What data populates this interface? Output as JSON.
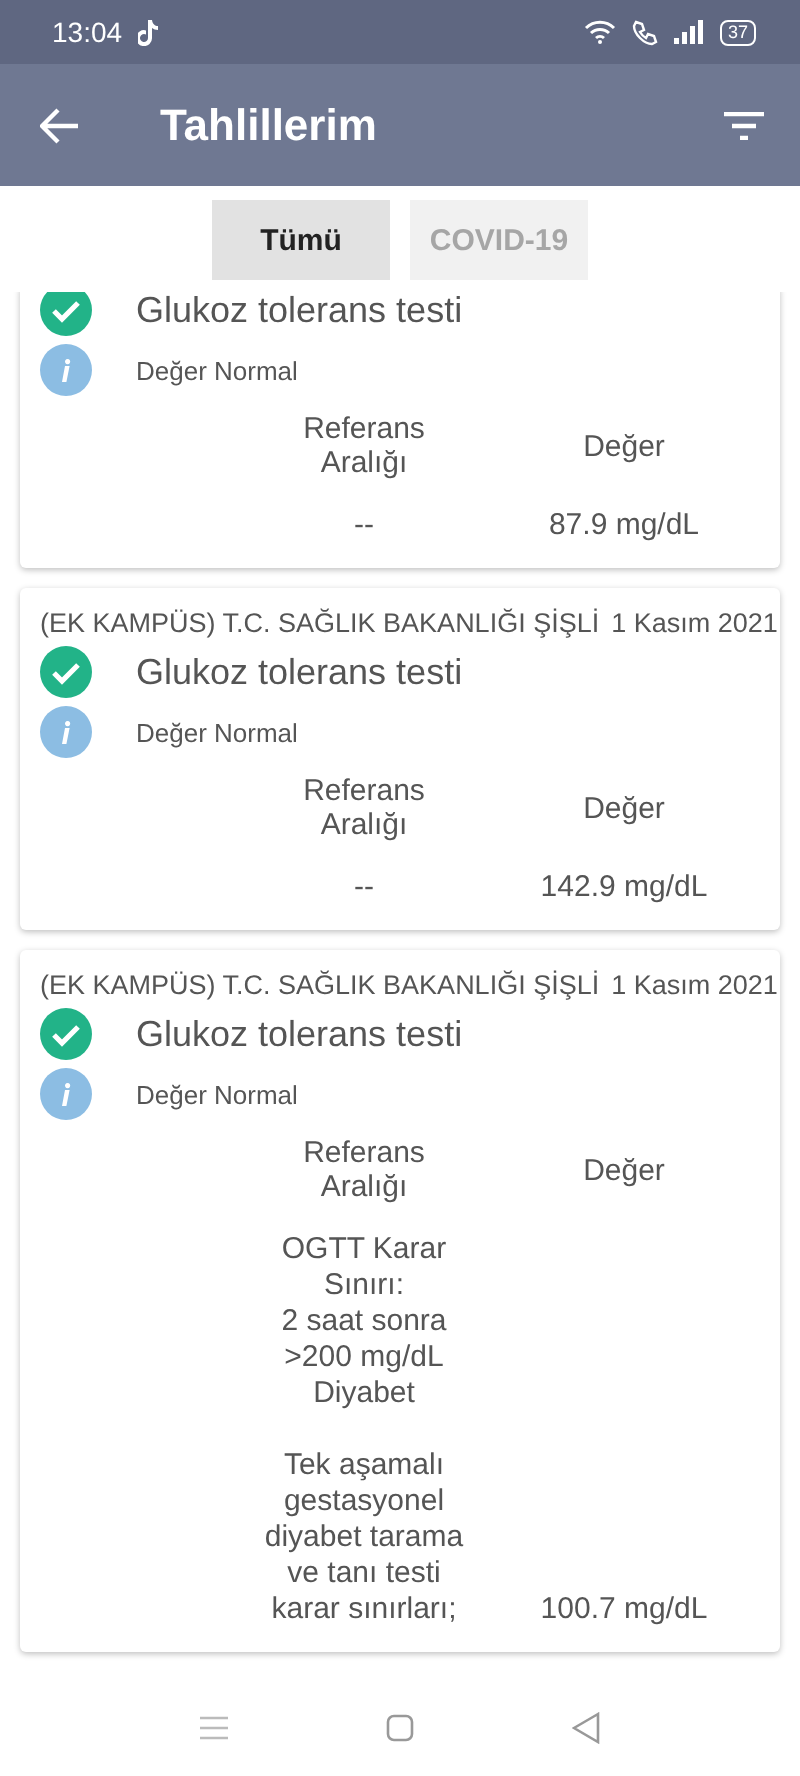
{
  "status_bar": {
    "time": "13:04",
    "battery": "37"
  },
  "app_bar": {
    "title": "Tahlillerim"
  },
  "tabs": [
    {
      "label": "Tümü",
      "selected": true
    },
    {
      "label": "COVID-19",
      "selected": false
    }
  ],
  "results": [
    {
      "test": "Glukoz tolerans testi",
      "status": "Değer Normal",
      "reference_header": "Referans\nAralığı",
      "value_header": "Değer",
      "reference": "--",
      "value": "87.9 mg/dL"
    },
    {
      "hospital": "(EK KAMPÜS) T.C. SAĞLIK BAKANLIĞI ŞİŞLİ",
      "date": "1 Kasım 2021",
      "test": "Glukoz tolerans testi",
      "status": "Değer Normal",
      "reference_header": "Referans\nAralığı",
      "value_header": "Değer",
      "reference": "--",
      "value": "142.9 mg/dL"
    },
    {
      "hospital": "(EK KAMPÜS) T.C. SAĞLIK BAKANLIĞI ŞİŞLİ",
      "date": "1 Kasım 2021",
      "test": "Glukoz tolerans testi",
      "status": "Değer Normal",
      "reference_header": "Referans\nAralığı",
      "value_header": "Değer",
      "reference": "OGTT Karar\nSınırı:\n2 saat sonra\n>200 mg/dL\nDiyabet\n\nTek aşamalı\ngestasyonel\ndiyabet tarama\nve tanı testi\nkarar sınırları;",
      "value": "100.7 mg/dL"
    }
  ]
}
